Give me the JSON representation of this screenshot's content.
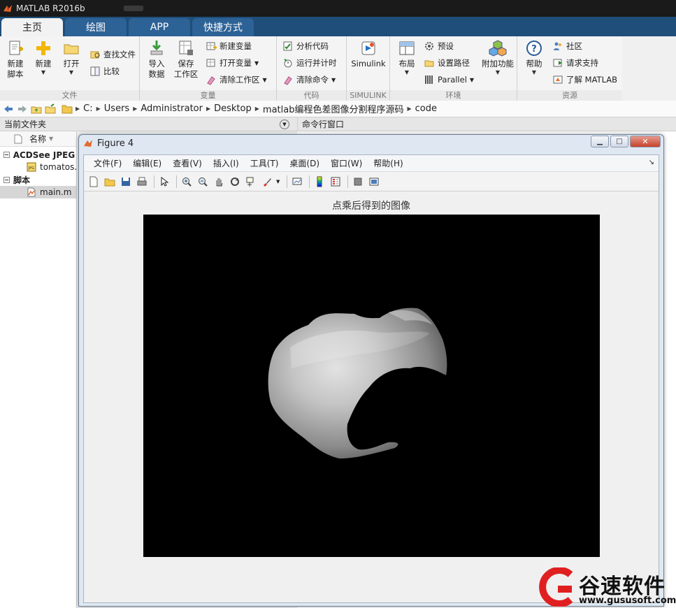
{
  "app": {
    "title": "MATLAB R2016b"
  },
  "tabs": [
    "主页",
    "绘图",
    "APP",
    "快捷方式"
  ],
  "ribbon": {
    "file": {
      "label": "文件",
      "new_script": [
        "新建",
        "脚本"
      ],
      "new": "新建",
      "open": "打开",
      "find_files": "查找文件",
      "compare": "比较"
    },
    "variable": {
      "label": "变量",
      "import_data": [
        "导入",
        "数据"
      ],
      "save_workspace": [
        "保存",
        "工作区"
      ],
      "new_variable": "新建变量",
      "open_variable": "打开变量",
      "clear_workspace": "清除工作区"
    },
    "code": {
      "label": "代码",
      "analyze": "分析代码",
      "run_time": "运行并计时",
      "clear_commands": "清除命令"
    },
    "simulink": {
      "label": "SIMULINK",
      "button": "Simulink"
    },
    "environment": {
      "label": "环境",
      "layout": "布局",
      "preferences": "预设",
      "set_path": "设置路径",
      "parallel": "Parallel",
      "addons": "附加功能"
    },
    "resources": {
      "label": "资源",
      "help": "帮助",
      "community": "社区",
      "request_support": "请求支持",
      "learn_matlab": "了解 MATLAB"
    }
  },
  "address": {
    "crumbs": [
      "C:",
      "Users",
      "Administrator",
      "Desktop",
      "matlab编程色差图像分割程序源码",
      "code"
    ]
  },
  "current_folder": {
    "title": "当前文件夹",
    "column": "名称",
    "groups": [
      {
        "label": "ACDSee JPEG 图",
        "file": "tomatos.jpg"
      },
      {
        "label": "脚本",
        "file": "main.m"
      }
    ]
  },
  "command_window": {
    "title": "命令行窗口"
  },
  "figure": {
    "title": "Figure 4",
    "menu": [
      "文件(F)",
      "编辑(E)",
      "查看(V)",
      "插入(I)",
      "工具(T)",
      "桌面(D)",
      "窗口(W)",
      "帮助(H)"
    ],
    "axes_title": "点乘后得到的图像"
  },
  "watermark": {
    "brand": "谷速软件",
    "url": "www.gususoft.com"
  }
}
